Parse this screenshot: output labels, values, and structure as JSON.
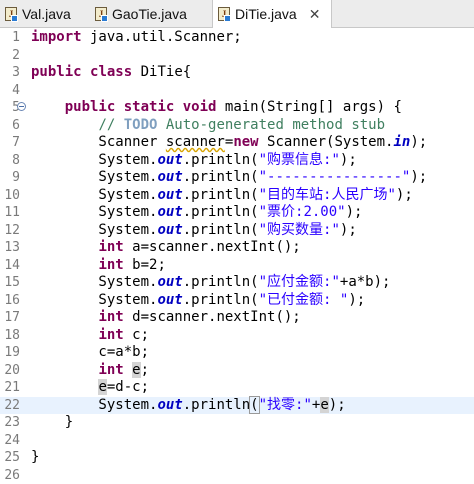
{
  "tabs": [
    {
      "label": "Val.java",
      "active": false
    },
    {
      "label": "GaoTie.java",
      "active": false
    },
    {
      "label": "DiTie.java",
      "active": true
    }
  ],
  "close_glyph": "✕",
  "code_lines": [
    {
      "n": "1",
      "html": "<span class=\"kw\">import</span> java.util.Scanner;"
    },
    {
      "n": "2",
      "html": ""
    },
    {
      "n": "3",
      "html": "<span class=\"kw\">public</span> <span class=\"kw\">class</span> DiTie{"
    },
    {
      "n": "4",
      "html": ""
    },
    {
      "n": "5",
      "fold": true,
      "html": "    <span class=\"kw\">public</span> <span class=\"kw\">static</span> <span class=\"kw\">void</span> main(String[] args) {"
    },
    {
      "n": "6",
      "html": "        <span class=\"cm\">// <span class=\"todo\">TODO</span> Auto-generated method stub</span>"
    },
    {
      "n": "7",
      "html": "        Scanner <span class=\"warn\">scanner</span>=<span class=\"kw\">new</span> Scanner(System.<span class=\"fld\">in</span>);"
    },
    {
      "n": "8",
      "html": "        System.<span class=\"fld\">out</span>.println(<span class=\"str\">\"购票信息:\"</span>);"
    },
    {
      "n": "9",
      "html": "        System.<span class=\"fld\">out</span>.println(<span class=\"str\">\"----------------\"</span>);"
    },
    {
      "n": "10",
      "html": "        System.<span class=\"fld\">out</span>.println(<span class=\"str\">\"目的车站:人民广场\"</span>);"
    },
    {
      "n": "11",
      "html": "        System.<span class=\"fld\">out</span>.println(<span class=\"str\">\"票价:2.00\"</span>);"
    },
    {
      "n": "12",
      "html": "        System.<span class=\"fld\">out</span>.println(<span class=\"str\">\"购买数量:\"</span>);"
    },
    {
      "n": "13",
      "html": "        <span class=\"kw\">int</span> a=scanner.nextInt();"
    },
    {
      "n": "14",
      "html": "        <span class=\"kw\">int</span> b=2;"
    },
    {
      "n": "15",
      "html": "        System.<span class=\"fld\">out</span>.println(<span class=\"str\">\"应付金额:\"</span>+a*b);"
    },
    {
      "n": "16",
      "html": "        System.<span class=\"fld\">out</span>.println(<span class=\"str\">\"已付金额: \"</span>);"
    },
    {
      "n": "17",
      "html": "        <span class=\"kw\">int</span> d=scanner.nextInt();"
    },
    {
      "n": "18",
      "html": "        <span class=\"kw\">int</span> c;"
    },
    {
      "n": "19",
      "html": "        c=a*b;"
    },
    {
      "n": "20",
      "html": "        <span class=\"kw\">int</span> <span class=\"hl\">e</span>;"
    },
    {
      "n": "21",
      "html": "        <span class=\"hl\">e</span>=d-c;"
    },
    {
      "n": "22",
      "current": true,
      "html": "        System.<span class=\"fld\">out</span>.println<span class=\"bracket\">(</span><span class=\"str\">\"找零:\"</span>+<span class=\"hl\">e</span>);"
    },
    {
      "n": "23",
      "html": "    }"
    },
    {
      "n": "24",
      "html": ""
    },
    {
      "n": "25",
      "html": "}"
    },
    {
      "n": "26",
      "html": ""
    }
  ]
}
